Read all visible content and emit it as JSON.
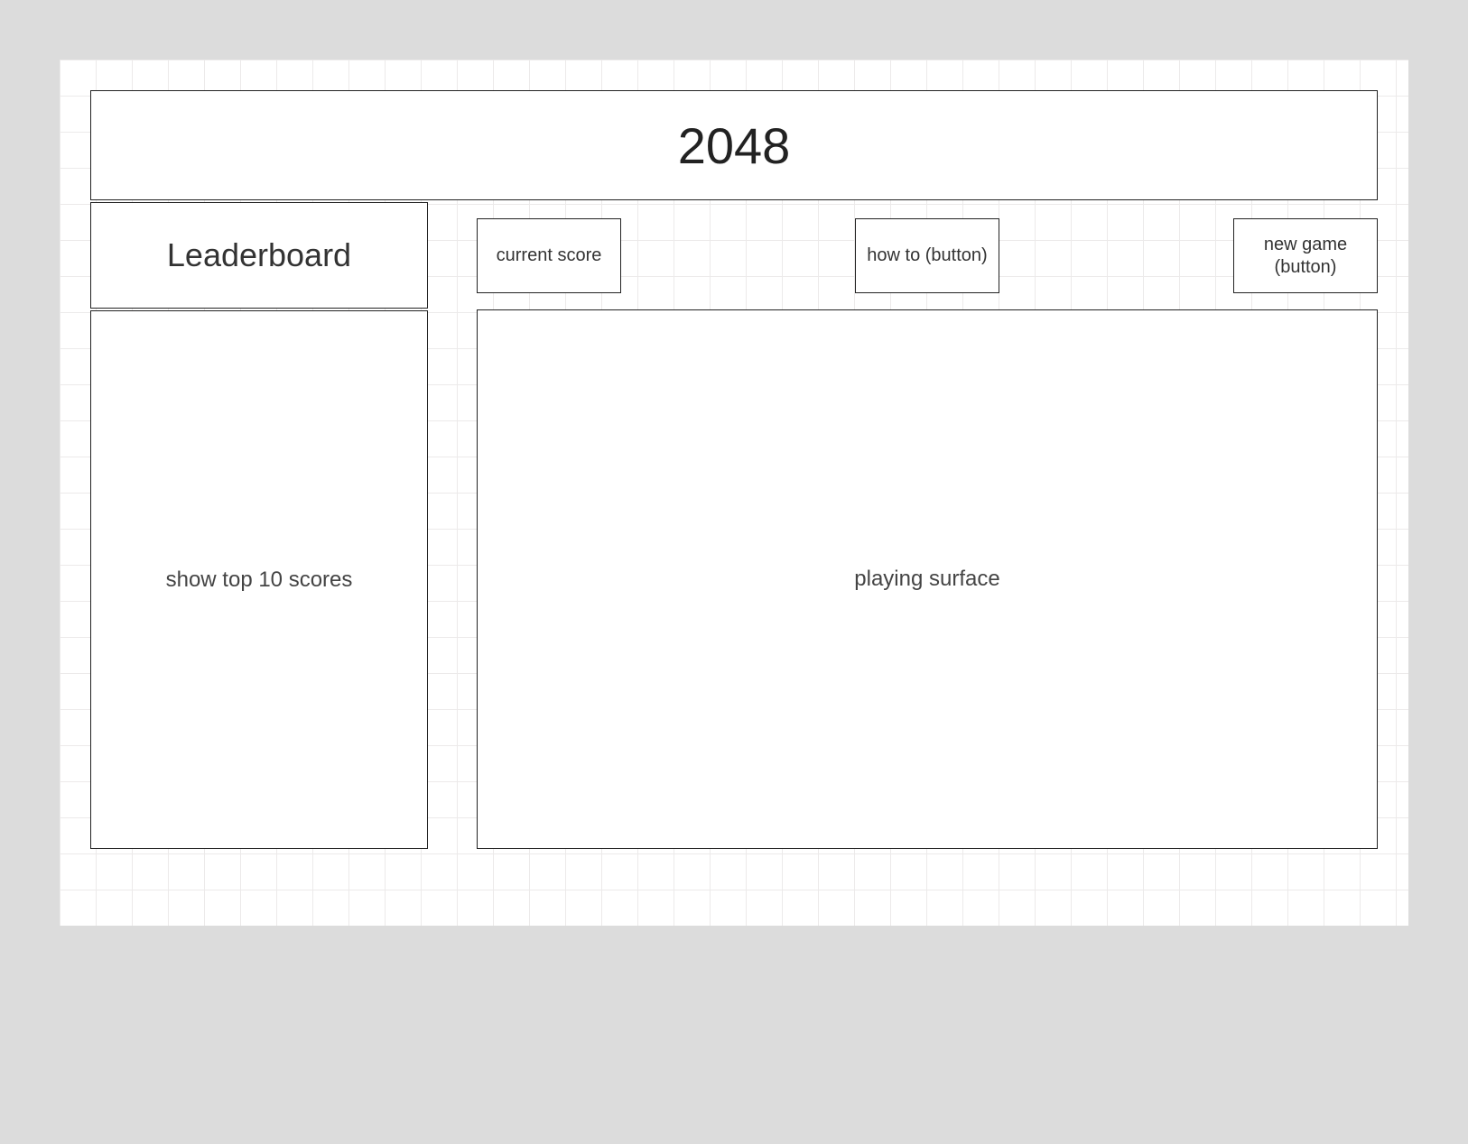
{
  "title": "2048",
  "leaderboard": {
    "header": "Leaderboard",
    "body": "show top 10 scores"
  },
  "controls": {
    "score_label": "current score",
    "howto_label": "how to (button)",
    "newgame_label": "new game (button)"
  },
  "board": {
    "label": "playing surface"
  },
  "colors": {
    "page_bg": "#dcdcdc",
    "panel_bg": "#ffffff",
    "grid_line": "#eceaea",
    "box_border": "#222222"
  }
}
